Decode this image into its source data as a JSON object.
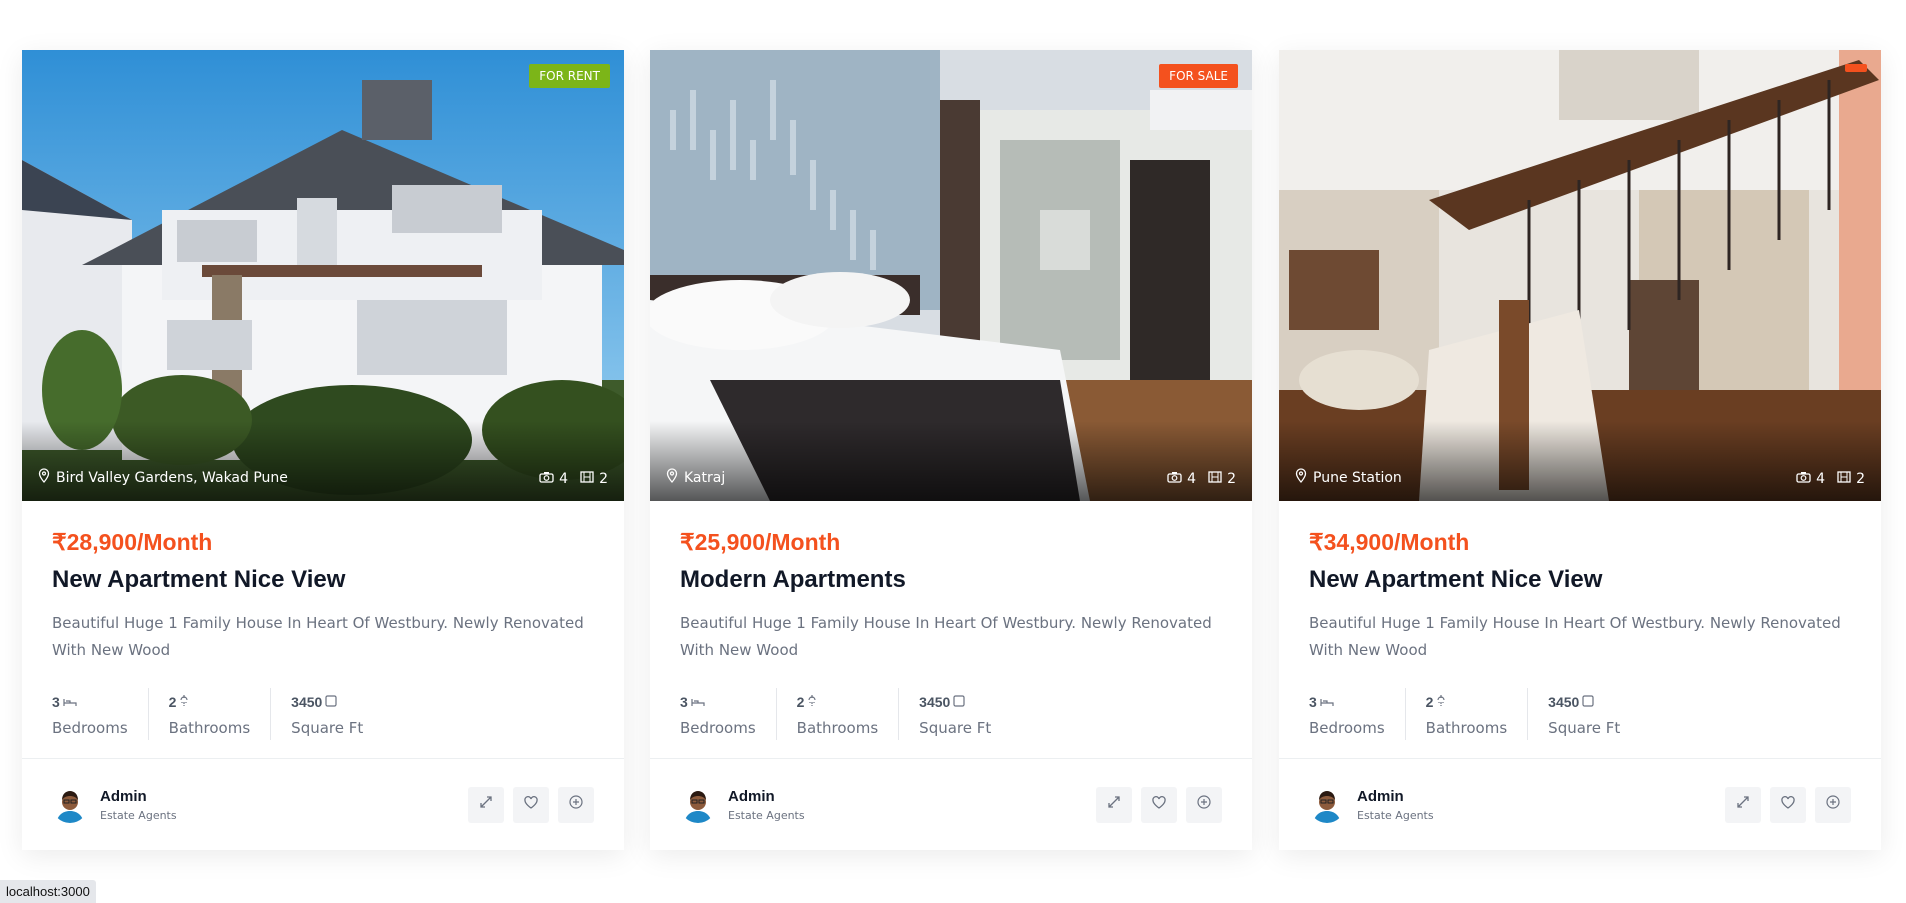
{
  "status_bar": {
    "url": "localhost:3000"
  },
  "colors": {
    "price": "#f4511e",
    "for_rent": "#7cb518",
    "for_sale": "#f4511e"
  },
  "cards": [
    {
      "badge": "FOR RENT",
      "location": "Bird Valley Gardens, Wakad Pune",
      "photos": "4",
      "videos": "2",
      "price": "₹28,900/Month",
      "title": "New Apartment Nice View",
      "description": "Beautiful Huge 1 Family House In Heart Of Westbury. Newly Renovated With New Wood",
      "stats": [
        {
          "value": "3",
          "label": "Bedrooms",
          "icon": "bed-icon"
        },
        {
          "value": "2",
          "label": "Bathrooms",
          "icon": "shower-icon"
        },
        {
          "value": "3450",
          "label": "Square Ft",
          "icon": "square-icon"
        }
      ],
      "agent": {
        "name": "Admin",
        "role": "Estate Agents"
      }
    },
    {
      "badge": "FOR SALE",
      "location": "Katraj",
      "photos": "4",
      "videos": "2",
      "price": "₹25,900/Month",
      "title": "Modern Apartments",
      "description": "Beautiful Huge 1 Family House In Heart Of Westbury. Newly Renovated With New Wood",
      "stats": [
        {
          "value": "3",
          "label": "Bedrooms",
          "icon": "bed-icon"
        },
        {
          "value": "2",
          "label": "Bathrooms",
          "icon": "shower-icon"
        },
        {
          "value": "3450",
          "label": "Square Ft",
          "icon": "square-icon"
        }
      ],
      "agent": {
        "name": "Admin",
        "role": "Estate Agents"
      }
    },
    {
      "badge": "",
      "location": "Pune Station",
      "photos": "4",
      "videos": "2",
      "price": "₹34,900/Month",
      "title": "New Apartment Nice View",
      "description": "Beautiful Huge 1 Family House In Heart Of Westbury. Newly Renovated With New Wood",
      "stats": [
        {
          "value": "3",
          "label": "Bedrooms",
          "icon": "bed-icon"
        },
        {
          "value": "2",
          "label": "Bathrooms",
          "icon": "shower-icon"
        },
        {
          "value": "3450",
          "label": "Square Ft",
          "icon": "square-icon"
        }
      ],
      "agent": {
        "name": "Admin",
        "role": "Estate Agents"
      }
    }
  ]
}
